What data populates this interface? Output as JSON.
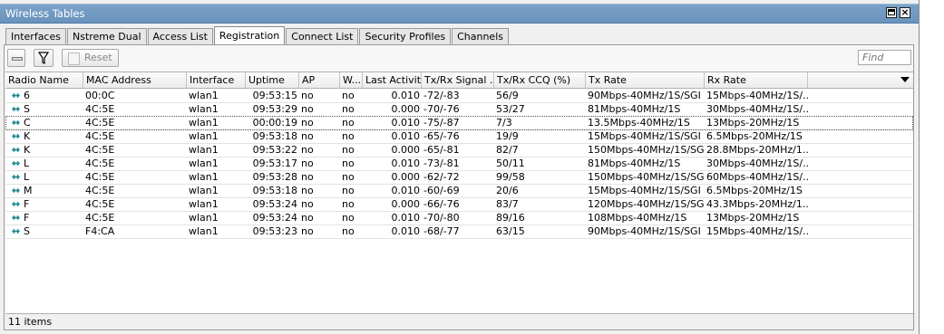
{
  "window": {
    "title": "Wireless Tables"
  },
  "tabs": [
    {
      "label": "Interfaces"
    },
    {
      "label": "Nstreme Dual"
    },
    {
      "label": "Access List"
    },
    {
      "label": "Registration"
    },
    {
      "label": "Connect List"
    },
    {
      "label": "Security Profiles"
    },
    {
      "label": "Channels"
    }
  ],
  "active_tab": "Registration",
  "toolbar": {
    "reset_label": "Reset",
    "find_placeholder": "Find"
  },
  "columns": [
    {
      "label": "Radio Name"
    },
    {
      "label": "MAC Address"
    },
    {
      "label": "Interface"
    },
    {
      "label": "Uptime"
    },
    {
      "label": "AP"
    },
    {
      "label": "W..."
    },
    {
      "label": "Last Activit..."
    },
    {
      "label": "Tx/Rx Signal ..."
    },
    {
      "label": "Tx/Rx CCQ (%)"
    },
    {
      "label": "Tx Rate"
    },
    {
      "label": "Rx Rate"
    }
  ],
  "rows": [
    {
      "radio": "6",
      "mac": "00:0C",
      "iface": "wlan1",
      "uptime": "09:53:15",
      "ap": "no",
      "w": "no",
      "last": "0.010",
      "signal": "-72/-83",
      "ccq": "56/9",
      "tx": "90Mbps-40MHz/1S/SGI",
      "rx": "15Mbps-40MHz/1S/..."
    },
    {
      "radio": "S",
      "mac": "4C:5E",
      "iface": "wlan1",
      "uptime": "09:53:29",
      "ap": "no",
      "w": "no",
      "last": "0.000",
      "signal": "-70/-76",
      "ccq": "53/27",
      "tx": "81Mbps-40MHz/1S",
      "rx": "30Mbps-40MHz/1S/..."
    },
    {
      "radio": "C",
      "mac": "4C:5E",
      "iface": "wlan1",
      "uptime": "00:00:19",
      "ap": "no",
      "w": "no",
      "last": "0.010",
      "signal": "-75/-87",
      "ccq": "7/3",
      "tx": "13.5Mbps-40MHz/1S",
      "rx": "13Mbps-20MHz/1S"
    },
    {
      "radio": "K",
      "mac": "4C:5E",
      "iface": "wlan1",
      "uptime": "09:53:18",
      "ap": "no",
      "w": "no",
      "last": "0.010",
      "signal": "-65/-76",
      "ccq": "19/9",
      "tx": "15Mbps-40MHz/1S/SGI",
      "rx": "6.5Mbps-20MHz/1S"
    },
    {
      "radio": "K",
      "mac": "4C:5E",
      "iface": "wlan1",
      "uptime": "09:53:22",
      "ap": "no",
      "w": "no",
      "last": "0.000",
      "signal": "-65/-81",
      "ccq": "82/7",
      "tx": "150Mbps-40MHz/1S/SGI",
      "rx": "28.8Mbps-20MHz/1..."
    },
    {
      "radio": "L",
      "mac": "4C:5E",
      "iface": "wlan1",
      "uptime": "09:53:17",
      "ap": "no",
      "w": "no",
      "last": "0.010",
      "signal": "-73/-81",
      "ccq": "50/11",
      "tx": "81Mbps-40MHz/1S",
      "rx": "30Mbps-40MHz/1S/..."
    },
    {
      "radio": "L",
      "mac": "4C:5E",
      "iface": "wlan1",
      "uptime": "09:53:28",
      "ap": "no",
      "w": "no",
      "last": "0.000",
      "signal": "-62/-72",
      "ccq": "99/58",
      "tx": "150Mbps-40MHz/1S/SGI",
      "rx": "60Mbps-40MHz/1S/..."
    },
    {
      "radio": "M",
      "mac": "4C:5E",
      "iface": "wlan1",
      "uptime": "09:53:18",
      "ap": "no",
      "w": "no",
      "last": "0.010",
      "signal": "-60/-69",
      "ccq": "20/6",
      "tx": "15Mbps-40MHz/1S/SGI",
      "rx": "6.5Mbps-20MHz/1S"
    },
    {
      "radio": "F",
      "mac": "4C:5E",
      "iface": "wlan1",
      "uptime": "09:53:24",
      "ap": "no",
      "w": "no",
      "last": "0.000",
      "signal": "-66/-76",
      "ccq": "83/7",
      "tx": "120Mbps-40MHz/1S/SGI",
      "rx": "43.3Mbps-20MHz/1..."
    },
    {
      "radio": "F",
      "mac": "4C:5E",
      "iface": "wlan1",
      "uptime": "09:53:24",
      "ap": "no",
      "w": "no",
      "last": "0.010",
      "signal": "-70/-80",
      "ccq": "89/16",
      "tx": "108Mbps-40MHz/1S",
      "rx": "13Mbps-20MHz/1S"
    },
    {
      "radio": "S",
      "mac": "F4:CA",
      "iface": "wlan1",
      "uptime": "09:53:23",
      "ap": "no",
      "w": "no",
      "last": "0.010",
      "signal": "-68/-77",
      "ccq": "63/15",
      "tx": "90Mbps-40MHz/1S/SGI",
      "rx": "15Mbps-40MHz/1S/..."
    }
  ],
  "selected_row": 3,
  "status": {
    "items_count": "11 items"
  },
  "colors": {
    "titlebar": "#6a93bd",
    "selection_outline": "#555555"
  }
}
